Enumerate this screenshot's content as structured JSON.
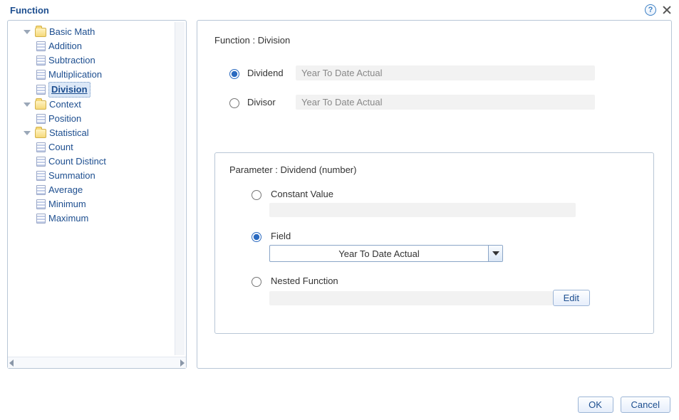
{
  "dialog": {
    "title": "Function",
    "ok": "OK",
    "cancel": "Cancel"
  },
  "tree": {
    "groups": [
      {
        "name": "Basic Math",
        "items": [
          "Addition",
          "Subtraction",
          "Multiplication",
          "Division"
        ],
        "selected": "Division"
      },
      {
        "name": "Context",
        "items": [
          "Position"
        ]
      },
      {
        "name": "Statistical",
        "items": [
          "Count",
          "Count Distinct",
          "Summation",
          "Average",
          "Minimum",
          "Maximum"
        ]
      }
    ]
  },
  "function": {
    "heading": "Function : Division",
    "params": [
      {
        "label": "Dividend",
        "value": "Year To Date Actual",
        "selected": true
      },
      {
        "label": "Divisor",
        "value": "Year To Date Actual",
        "selected": false
      }
    ]
  },
  "parameter": {
    "heading": "Parameter : Dividend (number)",
    "options": {
      "constant": "Constant Value",
      "field": "Field",
      "nested": "Nested Function"
    },
    "selected": "field",
    "field_value": "Year To Date Actual",
    "edit": "Edit"
  }
}
